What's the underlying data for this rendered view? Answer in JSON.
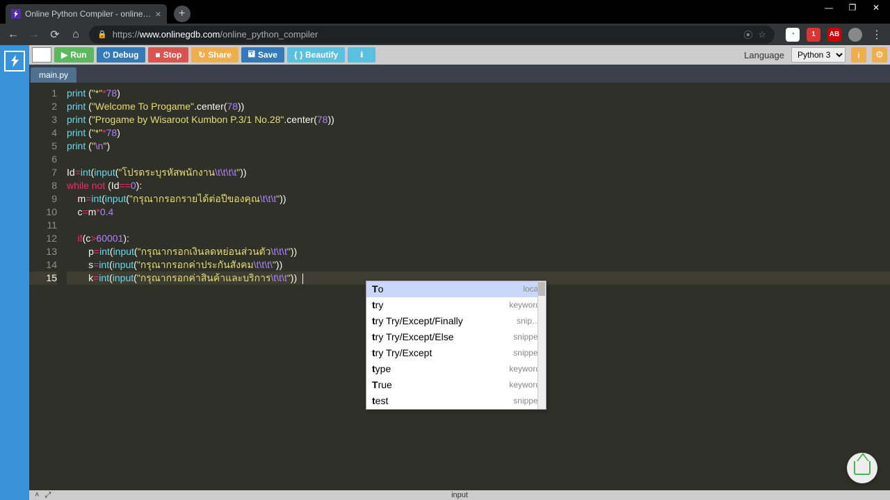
{
  "browser": {
    "tab_title": "Online Python Compiler - online…",
    "url_prefix": "https://",
    "url_domain": "www.onlinegdb.com",
    "url_path": "/online_python_compiler"
  },
  "toolbar": {
    "run": "Run",
    "debug": "Debug",
    "stop": "Stop",
    "share": "Share",
    "save": "Save",
    "beautify": "{ } Beautify",
    "language_label": "Language",
    "language_value": "Python 3"
  },
  "file_tab": "main.py",
  "gutter": [
    "1",
    "2",
    "3",
    "4",
    "5",
    "6",
    "7",
    "8",
    "9",
    "10",
    "11",
    "12",
    "13",
    "14",
    "15"
  ],
  "active_line_index": 14,
  "code": {
    "l1_a": "print",
    "l1_b": " (",
    "l1_c": "\"*\"",
    "l1_d": "*",
    "l1_e": "78",
    "l1_f": ")",
    "l2_a": "print",
    "l2_b": " (",
    "l2_c": "\"Welcome To Progame\"",
    "l2_d": ".center(",
    "l2_e": "78",
    "l2_f": "))",
    "l3_a": "print",
    "l3_b": " (",
    "l3_c": "\"Progame by Wisaroot Kumbon P.3/1 No.28\"",
    "l3_d": ".center(",
    "l3_e": "78",
    "l3_f": "))",
    "l4_a": "print",
    "l4_b": " (",
    "l4_c": "\"*\"",
    "l4_d": "*",
    "l4_e": "78",
    "l4_f": ")",
    "l5_a": "print",
    "l5_b": " (",
    "l5_c": "\"",
    "l5_d": "\\n",
    "l5_e": "\"",
    "l5_f": ")",
    "l7_a": "Id",
    "l7_b": "=",
    "l7_c": "int",
    "l7_d": "(",
    "l7_e": "input",
    "l7_f": "(",
    "l7_g": "\"โปรดระบุรหัสพนักงาน",
    "l7_h": "\\t\\t\\t\\t",
    "l7_i": "\"",
    "l7_j": "))",
    "l8_a": "while",
    "l8_b": " ",
    "l8_c": "not",
    "l8_d": " (Id",
    "l8_e": "==",
    "l8_f": "0",
    "l8_g": "):",
    "l9_a": "    m",
    "l9_b": "=",
    "l9_c": "int",
    "l9_d": "(",
    "l9_e": "input",
    "l9_f": "(",
    "l9_g": "\"กรุณากรอกรายได้ต่อปีของคุณ",
    "l9_h": "\\t\\t\\t",
    "l9_i": "\"",
    "l9_j": "))",
    "l10_a": "    c",
    "l10_b": "=",
    "l10_c": "m",
    "l10_d": "*",
    "l10_e": "0.4",
    "l12_a": "    ",
    "l12_b": "if",
    "l12_c": "(c",
    "l12_d": ">",
    "l12_e": "60001",
    "l12_f": "):",
    "l13_a": "        p",
    "l13_b": "=",
    "l13_c": "int",
    "l13_d": "(",
    "l13_e": "input",
    "l13_f": "(",
    "l13_g": "\"กรุณากรอกเงินลดหย่อนส่วนตัว",
    "l13_h": "\\t\\t\\t",
    "l13_i": "\"",
    "l13_j": "))",
    "l14_a": "        s",
    "l14_b": "=",
    "l14_c": "int",
    "l14_d": "(",
    "l14_e": "input",
    "l14_f": "(",
    "l14_g": "\"กรุณากรอกค่าประกันสังคม",
    "l14_h": "\\t\\t\\t\\",
    "l14_i": "\"",
    "l14_j": "))",
    "l15_a": "        k",
    "l15_b": "=",
    "l15_c": "int",
    "l15_d": "(",
    "l15_e": "input",
    "l15_f": "(",
    "l15_g": "\"กรุณากรอกค่าสินค้าและบริการ",
    "l15_h": "\\t\\t\\t",
    "l15_i": "\"",
    "l15_j": "))  "
  },
  "autocomplete": [
    {
      "prefix": "T",
      "rest": "o",
      "type": "local"
    },
    {
      "prefix": "t",
      "rest": "ry",
      "type": "keyword"
    },
    {
      "prefix": "t",
      "rest": "ry Try/Except/Finally",
      "type": "snip…"
    },
    {
      "prefix": "t",
      "rest": "ry Try/Except/Else",
      "type": "snippet"
    },
    {
      "prefix": "t",
      "rest": "ry Try/Except",
      "type": "snippet"
    },
    {
      "prefix": "t",
      "rest": "ype",
      "type": "keyword"
    },
    {
      "prefix": "T",
      "rest": "rue",
      "type": "keyword"
    },
    {
      "prefix": "t",
      "rest": "est",
      "type": "snippet"
    }
  ],
  "bottom": {
    "input_label": "input"
  }
}
